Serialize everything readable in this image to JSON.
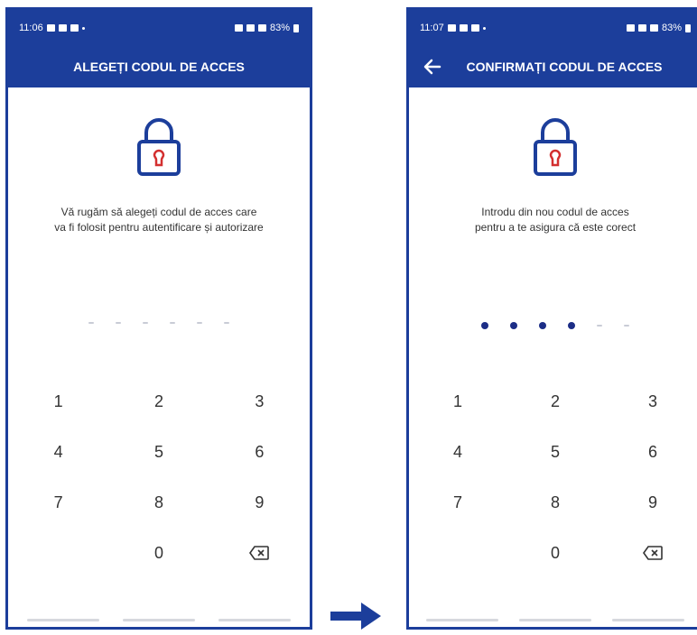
{
  "colors": {
    "primary": "#1c3e9b",
    "dot_filled": "#1c2d86",
    "lock_inner": "#d32f2f"
  },
  "left": {
    "status": {
      "time": "11:06",
      "battery": "83%"
    },
    "title": "ALEGEȚI CODUL DE ACCES",
    "message_line1": "Vă rugăm să alegeți codul de acces care",
    "message_line2": "va fi folosit pentru autentificare și autorizare",
    "pin_filled": 0,
    "pin_length": 6
  },
  "right": {
    "status": {
      "time": "11:07",
      "battery": "83%"
    },
    "title": "CONFIRMAȚI CODUL DE ACCES",
    "message_line1": "Introdu din nou codul de acces",
    "message_line2": "pentru a te asigura că este corect",
    "pin_filled": 4,
    "pin_length": 6
  },
  "keypad": {
    "keys": [
      "1",
      "2",
      "3",
      "4",
      "5",
      "6",
      "7",
      "8",
      "9",
      "",
      "0",
      "⌫"
    ]
  },
  "icons": {
    "back": "arrow-left-icon",
    "lock": "lock-icon",
    "delete": "backspace-icon",
    "transition": "arrow-right-icon"
  }
}
